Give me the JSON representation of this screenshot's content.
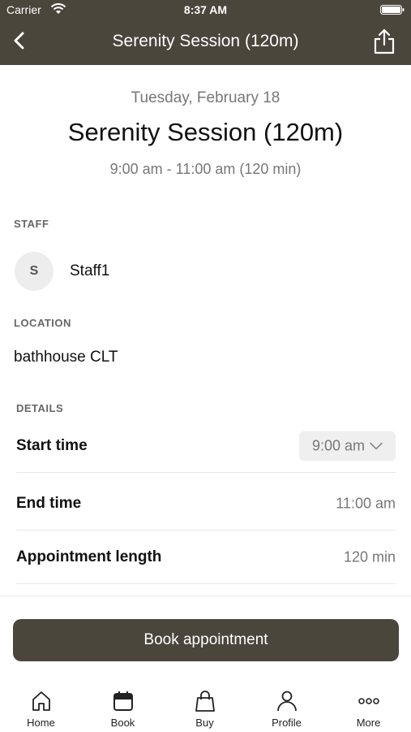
{
  "status_bar": {
    "carrier": "Carrier",
    "time": "8:37 AM"
  },
  "nav": {
    "title": "Serenity Session (120m)"
  },
  "appointment": {
    "date": "Tuesday, February 18",
    "title": "Serenity Session (120m)",
    "time_range": "9:00 am - 11:00 am (120 min)"
  },
  "staff": {
    "section_label": "STAFF",
    "avatar_initial": "S",
    "name": "Staff1"
  },
  "location": {
    "section_label": "LOCATION",
    "value": "bathhouse CLT"
  },
  "details": {
    "section_label": "DETAILS",
    "start_time": {
      "label": "Start time",
      "value": "9:00 am"
    },
    "end_time": {
      "label": "End time",
      "value": "11:00 am"
    },
    "length": {
      "label": "Appointment length",
      "value": "120 min"
    }
  },
  "book_button": {
    "label": "Book appointment"
  },
  "tabbar": {
    "tabs": [
      {
        "label": "Home",
        "icon": "home-icon"
      },
      {
        "label": "Book",
        "icon": "calendar-icon"
      },
      {
        "label": "Buy",
        "icon": "shopping-bag-icon"
      },
      {
        "label": "Profile",
        "icon": "person-icon"
      },
      {
        "label": "More",
        "icon": "more-dots-icon"
      }
    ]
  },
  "colors": {
    "brand": "#4a463c",
    "muted_text": "#777777"
  }
}
